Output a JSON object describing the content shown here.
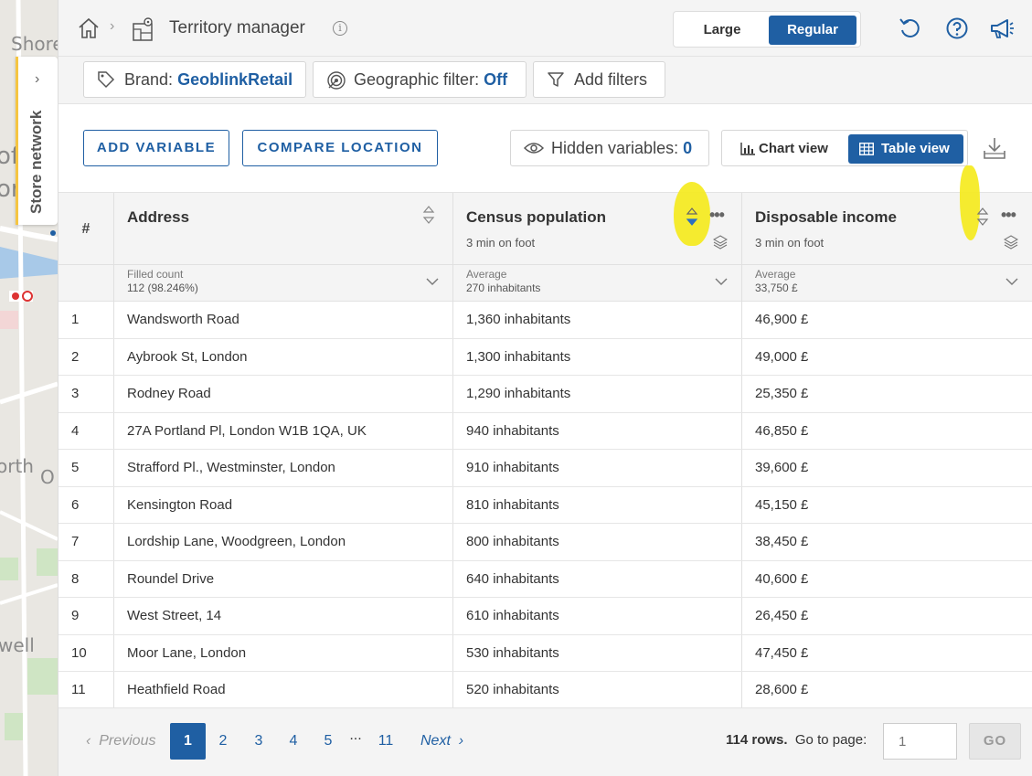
{
  "map": {
    "labels": [
      "Shore",
      "of",
      "or",
      "orth",
      "O",
      "well"
    ],
    "store_network_label": "Store network"
  },
  "topbar": {
    "title": "Territory manager",
    "size_options": {
      "large": "Large",
      "regular": "Regular",
      "selected": "Regular"
    },
    "icons": [
      "home-icon",
      "territory-icon",
      "info-icon",
      "undo-icon",
      "help-icon",
      "megaphone-icon"
    ]
  },
  "filters": {
    "brand_label": "Brand:",
    "brand_value": "GeoblinkRetail",
    "geo_label": "Geographic filter:",
    "geo_value": "Off",
    "add_filters": "Add filters"
  },
  "toolbar": {
    "add_variable": "ADD VARIABLE",
    "compare_location": "COMPARE LOCATION",
    "hidden_label": "Hidden variables:",
    "hidden_count": "0",
    "chart_view": "Chart view",
    "table_view": "Table view",
    "selected_view": "Table view"
  },
  "table": {
    "hash": "#",
    "columns": [
      {
        "title": "Address",
        "subtitle": "",
        "agg": "Filled count",
        "agg_value": "112 (98.246%)"
      },
      {
        "title": "Census population",
        "subtitle": "3 min on foot",
        "agg": "Average",
        "agg_value": "270 inhabitants"
      },
      {
        "title": "Disposable income",
        "subtitle": "3 min on foot",
        "agg": "Average",
        "agg_value": "33,750 £"
      }
    ],
    "rows": [
      [
        "1",
        "Wandsworth Road",
        "1,360 inhabitants",
        "46,900 £"
      ],
      [
        "2",
        "Aybrook St, London",
        "1,300 inhabitants",
        "49,000 £"
      ],
      [
        "3",
        "Rodney Road",
        "1,290 inhabitants",
        "25,350 £"
      ],
      [
        "4",
        "27A Portland Pl, London W1B 1QA, UK",
        "940 inhabitants",
        "46,850 £"
      ],
      [
        "5",
        "Strafford Pl., Westminster, London",
        "910 inhabitants",
        "39,600 £"
      ],
      [
        "6",
        "Kensington Road",
        "810 inhabitants",
        "45,150 £"
      ],
      [
        "7",
        "Lordship Lane, Woodgreen, London",
        "800 inhabitants",
        "38,450 £"
      ],
      [
        "8",
        "Roundel Drive",
        "640 inhabitants",
        "40,600 £"
      ],
      [
        "9",
        "West Street, 14",
        "610 inhabitants",
        "26,450 £"
      ],
      [
        "10",
        "Moor Lane, London",
        "530 inhabitants",
        "47,450 £"
      ],
      [
        "11",
        "Heathfield Road",
        "520 inhabitants",
        "28,600 £"
      ]
    ]
  },
  "pagination": {
    "previous": "Previous",
    "next": "Next",
    "pages": [
      "1",
      "2",
      "3",
      "4",
      "5",
      "...",
      "11"
    ],
    "current": "1",
    "rows_count": "114 rows.",
    "goto_label": "Go to page:",
    "goto_placeholder": "1",
    "go": "GO"
  },
  "colors": {
    "accent": "#1f5fa3",
    "highlight": "#f5ea1a"
  }
}
